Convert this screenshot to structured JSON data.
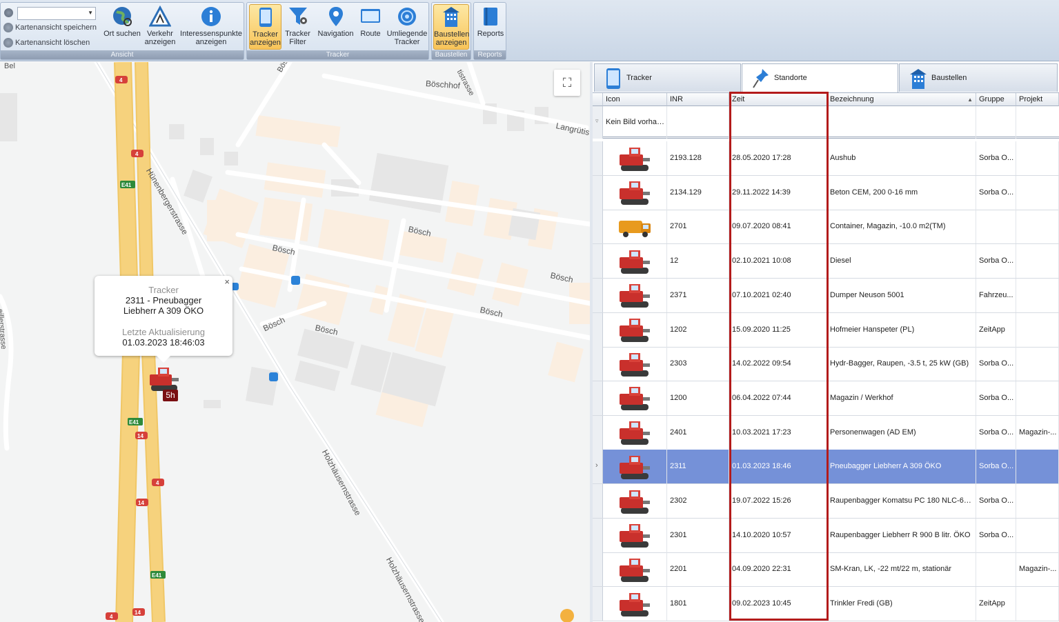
{
  "ribbon": {
    "ansicht": {
      "label": "Ansicht",
      "save_view": "Kartenansicht speichern",
      "delete_view": "Kartenansicht löschen",
      "combo_value": "",
      "buttons": [
        {
          "l1": "Ort suchen",
          "l2": "",
          "icon": "globe-search-icon"
        },
        {
          "l1": "Verkehr",
          "l2": "anzeigen",
          "icon": "traffic-sign-icon"
        },
        {
          "l1": "Interessenspunkte",
          "l2": "anzeigen",
          "icon": "info-icon"
        }
      ]
    },
    "tracker": {
      "label": "Tracker",
      "buttons": [
        {
          "l1": "Tracker",
          "l2": "anzeigen",
          "icon": "tablet-icon",
          "active": true
        },
        {
          "l1": "Tracker",
          "l2": "Filter",
          "icon": "funnel-gear-icon"
        },
        {
          "l1": "Navigation",
          "l2": "",
          "icon": "map-pin-icon"
        },
        {
          "l1": "Route",
          "l2": "",
          "icon": "monitor-icon"
        },
        {
          "l1": "Umliegende",
          "l2": "Tracker",
          "icon": "radar-icon"
        }
      ]
    },
    "baustellen": {
      "label": "Baustellen",
      "button": {
        "l1": "Baustellen",
        "l2": "anzeigen",
        "icon": "building-icon"
      }
    },
    "reports": {
      "label": "Reports",
      "button": {
        "l1": "Reports",
        "l2": "",
        "icon": "report-icon"
      }
    }
  },
  "map": {
    "streets": [
      "Bösch",
      "Böschhof",
      "Langrütis",
      "Hünenbergerstrasse",
      "Bösch",
      "Bösch",
      "Bösch",
      "Bösch",
      "Bösch",
      "Bösch",
      "Holzhäusernstrasse",
      "Holzhäusernstrasse",
      "tistrasse",
      "Bel",
      "eillerstrasse"
    ],
    "road_shields": [
      "4",
      "4",
      "E41",
      "E41",
      "14",
      "4",
      "14",
      "E41",
      "4",
      "14"
    ],
    "popup": {
      "heading": "Tracker",
      "line1": "2311 - Pneubagger",
      "line2": "Liebherr A 309 ÖKO",
      "update_label": "Letzte Aktualisierung",
      "update_value": "01.03.2023 18:46:03",
      "close": "×"
    },
    "marker_age": "5h",
    "fullscreen_glyph": "⛶"
  },
  "panel": {
    "tabs": [
      {
        "label": "Tracker",
        "icon": "tablet-icon"
      },
      {
        "label": "Standorte",
        "icon": "pushpin-icon",
        "active": true
      },
      {
        "label": "Baustellen",
        "icon": "building-icon"
      }
    ],
    "columns": [
      "Icon",
      "INR",
      "Zeit",
      "Bezeichnung",
      "Gruppe",
      "Projekt"
    ],
    "filter_text": "Kein Bild vorhan...",
    "rows": [
      {
        "inr": "2193.128",
        "zeit": "28.05.2020 17:28",
        "bez": "Aushub",
        "gruppe": "Sorba O...",
        "projekt": "",
        "icon": "excavator-icon"
      },
      {
        "inr": "2134.129",
        "zeit": "29.11.2022 14:39",
        "bez": "Beton CEM, 200  0-16 mm",
        "gruppe": "Sorba O...",
        "projekt": "",
        "icon": "excavator-icon"
      },
      {
        "inr": "2701",
        "zeit": "09.07.2020 08:41",
        "bez": "Container, Magazin, -10.0 m2(TM)",
        "gruppe": "",
        "projekt": "",
        "icon": "truck-icon"
      },
      {
        "inr": "12",
        "zeit": "02.10.2021 10:08",
        "bez": "Diesel",
        "gruppe": "Sorba O...",
        "projekt": "",
        "icon": "excavator-icon"
      },
      {
        "inr": "2371",
        "zeit": "07.10.2021 02:40",
        "bez": "Dumper Neuson 5001",
        "gruppe": "Fahrzeu...",
        "projekt": "",
        "icon": "excavator-icon"
      },
      {
        "inr": "1202",
        "zeit": "15.09.2020 11:25",
        "bez": "Hofmeier Hanspeter (PL)",
        "gruppe": "ZeitApp",
        "projekt": "",
        "icon": "excavator-icon"
      },
      {
        "inr": "2303",
        "zeit": "14.02.2022 09:54",
        "bez": "Hydr-Bagger, Raupen, -3.5 t, 25 kW (GB)",
        "gruppe": "Sorba O...",
        "projekt": "",
        "icon": "excavator-icon"
      },
      {
        "inr": "1200",
        "zeit": "06.04.2022 07:44",
        "bez": "Magazin / Werkhof",
        "gruppe": "Sorba O...",
        "projekt": "",
        "icon": "excavator-icon"
      },
      {
        "inr": "2401",
        "zeit": "10.03.2021 17:23",
        "bez": "Personenwagen (AD EM)",
        "gruppe": "Sorba O...",
        "projekt": "Magazin-...",
        "icon": "excavator-icon"
      },
      {
        "inr": "2311",
        "zeit": "01.03.2023 18:46",
        "bez": "Pneubagger Liebherr A 309 ÖKO",
        "gruppe": "Sorba O...",
        "projekt": "",
        "icon": "excavator-icon",
        "selected": true
      },
      {
        "inr": "2302",
        "zeit": "19.07.2022 15:26",
        "bez": "Raupenbagger Komatsu PC 180 NLC-6K ...",
        "gruppe": "Sorba O...",
        "projekt": "",
        "icon": "excavator-icon"
      },
      {
        "inr": "2301",
        "zeit": "14.10.2020 10:57",
        "bez": "Raupenbagger Liebherr R 900 B litr. ÖKO",
        "gruppe": "Sorba O...",
        "projekt": "",
        "icon": "excavator-icon"
      },
      {
        "inr": "2201",
        "zeit": "04.09.2020 22:31",
        "bez": "SM-Kran, LK, -22 mt/22 m, stationär",
        "gruppe": "",
        "projekt": "Magazin-...",
        "icon": "excavator-icon"
      },
      {
        "inr": "1801",
        "zeit": "09.02.2023 10:45",
        "bez": "Trinkler Fredi (GB)",
        "gruppe": "ZeitApp",
        "projekt": "",
        "icon": "excavator-icon"
      }
    ]
  },
  "colors": {
    "selection": "#7591d8",
    "highlight": "#b31b1b",
    "ribbon_active": "#f8c459",
    "motorway": "#f6d27d"
  }
}
